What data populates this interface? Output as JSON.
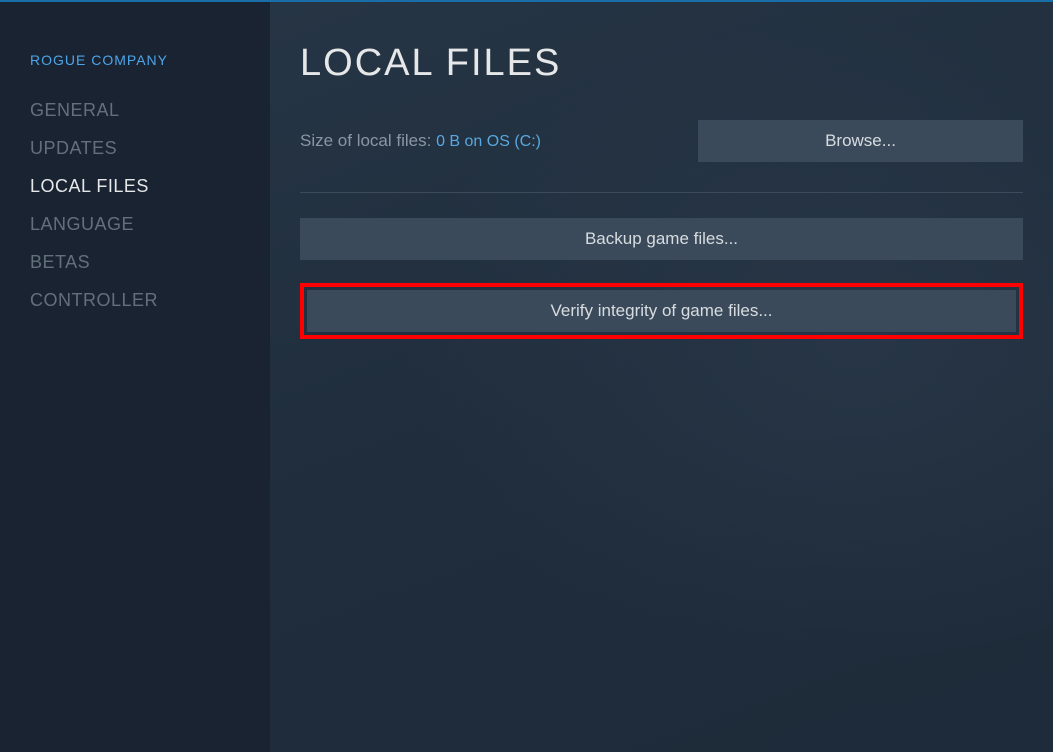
{
  "app": {
    "title": "ROGUE COMPANY"
  },
  "sidebar": {
    "items": [
      {
        "label": "GENERAL",
        "active": false
      },
      {
        "label": "UPDATES",
        "active": false
      },
      {
        "label": "LOCAL FILES",
        "active": true
      },
      {
        "label": "LANGUAGE",
        "active": false
      },
      {
        "label": "BETAS",
        "active": false
      },
      {
        "label": "CONTROLLER",
        "active": false
      }
    ]
  },
  "main": {
    "title": "LOCAL FILES",
    "size_label": "Size of local files: ",
    "size_value": "0 B on OS (C:)",
    "browse_button": "Browse...",
    "backup_button": "Backup game files...",
    "verify_button": "Verify integrity of game files..."
  }
}
